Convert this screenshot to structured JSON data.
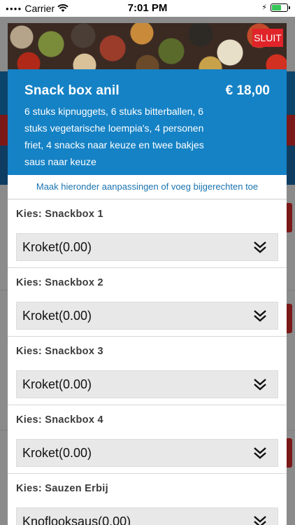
{
  "status": {
    "carrier": "Carrier",
    "time": "7:01 PM"
  },
  "modal": {
    "close_label": "SLUIT",
    "product": {
      "name": "Snack box anil",
      "price": "€ 18,00",
      "description": "6 stuks kipnuggets, 6 stuks bitterballen, 6 stuks vegetarische loempia's, 4 personen friet, 4 snacks naar keuze en twee bakjes saus naar keuze"
    },
    "hint": "Maak hieronder aanpassingen of voeg bijgerechten toe",
    "groups": [
      {
        "label": "Kies: Snackbox 1",
        "value": "Kroket(0.00)"
      },
      {
        "label": "Kies: Snackbox 2",
        "value": "Kroket(0.00)"
      },
      {
        "label": "Kies: Snackbox 3",
        "value": "Kroket(0.00)"
      },
      {
        "label": "Kies: Snackbox 4",
        "value": "Kroket(0.00)"
      },
      {
        "label": "Kies: Sauzen Erbij",
        "value": "Knoflooksaus(0.00)"
      }
    ]
  },
  "colors": {
    "accent": "#1582c5",
    "close": "#e0242a",
    "hint_text": "#1a73b0"
  },
  "icons": {
    "select": "double-chevron-down-icon",
    "wifi": "wifi-icon",
    "battery": "battery-icon"
  }
}
